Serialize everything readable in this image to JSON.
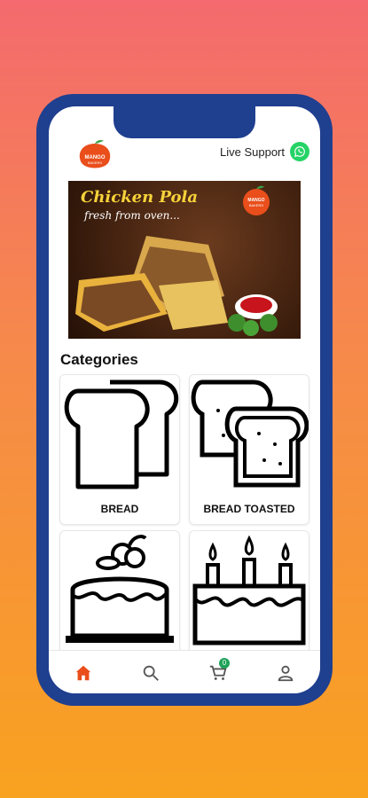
{
  "header": {
    "logo_text": "MANGO BAKERS",
    "support_label": "Live Support",
    "support_icon": "whatsapp-icon"
  },
  "banner": {
    "title": "Chicken Pola",
    "subtitle": "fresh from oven...",
    "logo_text": "MANGO BAKERS"
  },
  "categories": {
    "title": "Categories",
    "items": [
      {
        "label": "BREAD",
        "icon": "bread-icon"
      },
      {
        "label": "BREAD TOASTED",
        "icon": "toasted-bread-icon"
      },
      {
        "label": "",
        "icon": "cake-icon"
      },
      {
        "label": "",
        "icon": "birthday-cake-icon"
      }
    ]
  },
  "bottom_nav": {
    "items": [
      {
        "icon": "home-icon",
        "active": true
      },
      {
        "icon": "search-icon"
      },
      {
        "icon": "cart-icon",
        "badge": "0"
      },
      {
        "icon": "profile-icon"
      }
    ],
    "accent": "#e94e1b"
  },
  "colors": {
    "phone_frame": "#1f3f8f",
    "whatsapp": "#25d366",
    "badge": "#20a35a"
  }
}
